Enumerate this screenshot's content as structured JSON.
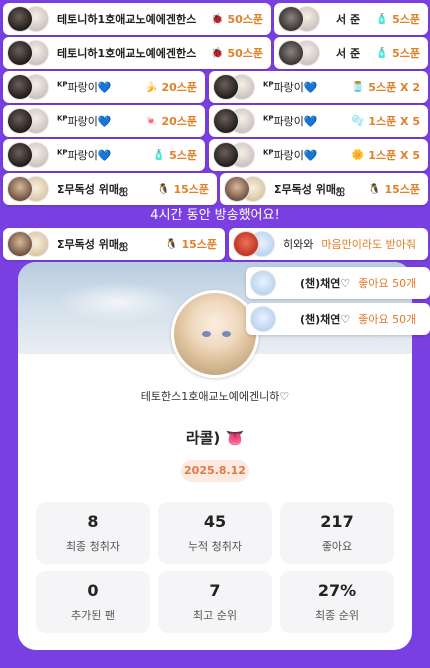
{
  "donations": {
    "row1_left": {
      "name": "테토니하1호애교노예에겐한스",
      "emoji": "🐞",
      "amount": "50스푼"
    },
    "row1_right": {
      "name": "서 준",
      "emoji": "🧴",
      "amount": "5스푼"
    },
    "row2_left": {
      "name": "테토니하1호애교노예에겐한스",
      "emoji": "🐞",
      "amount": "50스푼"
    },
    "row2_right": {
      "name": "서 준",
      "emoji": "🧴",
      "amount": "5스푼"
    },
    "row3_left": {
      "prefix": "KP",
      "name": "파랑이💙",
      "emoji": "🍌",
      "amount": "20스푼"
    },
    "row3_right": {
      "prefix": "KP",
      "name": "파랑이💙",
      "emoji": "🫙",
      "amount": "5스푼 X 2"
    },
    "row4_left": {
      "prefix": "KP",
      "name": "파랑이💙",
      "emoji": "🍬",
      "amount": "20스푼"
    },
    "row4_right": {
      "prefix": "KP",
      "name": "파랑이💙",
      "emoji": "🫧",
      "amount": "1스푼 X 5"
    },
    "row5_left": {
      "prefix": "KP",
      "name": "파랑이💙",
      "emoji": "🧴",
      "amount": "5스푼"
    },
    "row5_right": {
      "prefix": "KP",
      "name": "파랑이💙",
      "emoji": "🌼",
      "amount": "1스푼 X 5"
    },
    "row6_left": {
      "name": "Σ무독성 위매ஐ",
      "emoji": "🐧",
      "amount": "15스푼"
    },
    "row6_right": {
      "name": "Σ무독성 위매ஐ",
      "emoji": "🐧",
      "amount": "15스푼"
    },
    "row7_left": {
      "name": "Σ무독성 위매ஐ",
      "emoji": "🐧",
      "amount": "15스푼"
    },
    "row7_right": {
      "name": "히와와",
      "message": "마음만이라도 받아줘"
    }
  },
  "notice": "4시간 동안 방송했어요!",
  "likes": [
    {
      "name": "(챈)채연♡",
      "text": "좋아요 50개"
    },
    {
      "name": "(챈)채연♡",
      "text": "좋아요 50개"
    }
  ],
  "card": {
    "channel": "테토한스1호애교노예에겐니하♡",
    "title": "라콜) 👅",
    "date": "2025.8.12",
    "stats": [
      {
        "value": "8",
        "label": "최종 청취자"
      },
      {
        "value": "45",
        "label": "누적 청취자"
      },
      {
        "value": "217",
        "label": "좋아요"
      },
      {
        "value": "0",
        "label": "추가된 팬"
      },
      {
        "value": "7",
        "label": "최고 순위"
      },
      {
        "value": "27%",
        "label": "최종 순위"
      }
    ]
  },
  "colors": {
    "background": "#7a3fe0",
    "accent": "#e0812a",
    "date_badge": "#fde9e0"
  }
}
